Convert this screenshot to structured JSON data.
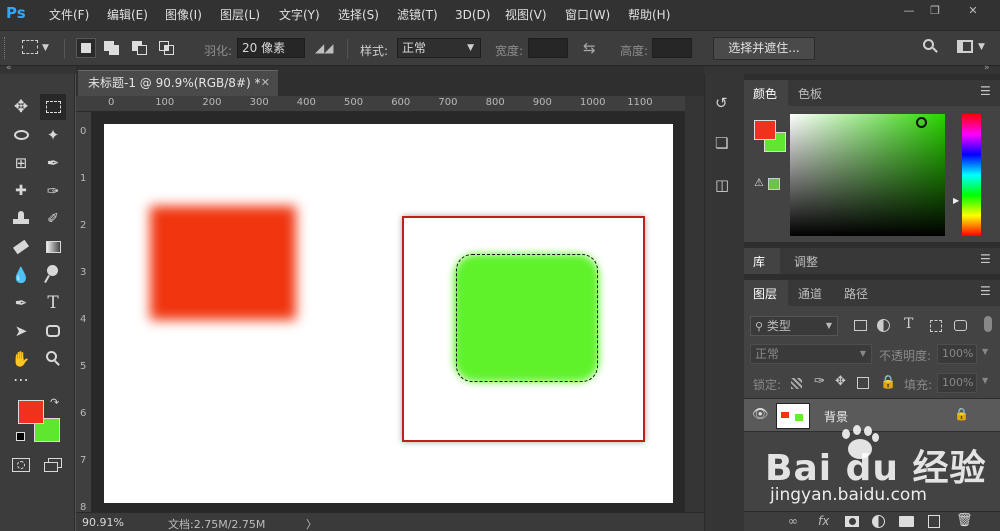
{
  "app": {
    "logo": "Ps"
  },
  "menu": [
    "文件(F)",
    "编辑(E)",
    "图像(I)",
    "图层(L)",
    "文字(Y)",
    "选择(S)",
    "滤镜(T)",
    "3D(D)",
    "视图(V)",
    "窗口(W)",
    "帮助(H)"
  ],
  "options": {
    "feather_label": "羽化:",
    "feather_value": "20 像素",
    "style_label": "样式:",
    "style_value": "正常",
    "width_label": "宽度:",
    "height_label": "高度:",
    "select_mask_button": "选择并遮住..."
  },
  "document": {
    "tab_title": "未标题-1 @ 90.9%(RGB/8#) *",
    "ruler_top": [
      "0",
      "100",
      "200",
      "300",
      "400",
      "500",
      "600",
      "700",
      "800",
      "900",
      "1000",
      "1100"
    ],
    "ruler_left": [
      "0",
      "1",
      "2",
      "3",
      "4",
      "5",
      "6",
      "7",
      "8"
    ],
    "status_zoom": "90.91%",
    "status_doc": "文档:2.75M/2.75M",
    "status_arrow": "〉"
  },
  "colors": {
    "foreground": "#f0311b",
    "background": "#5fe62e",
    "canvas_red": "#f0350f",
    "canvas_green": "#5ff22b",
    "frame_red": "#c0201c"
  },
  "color_panel": {
    "tabs": [
      "颜色",
      "色板"
    ]
  },
  "library_panel": {
    "tabs": [
      "库",
      "调整"
    ]
  },
  "layers_panel": {
    "tabs": [
      "图层",
      "通道",
      "路径"
    ],
    "filter_kind": "类型",
    "blend_mode": "正常",
    "opacity_label": "不透明度:",
    "opacity_value": "100%",
    "lock_label": "锁定:",
    "fill_label": "填充:",
    "fill_value": "100%",
    "layers": [
      {
        "name": "背景"
      }
    ],
    "footer_icons": [
      "link-icon",
      "fx-icon",
      "mask-icon",
      "adjustment-icon",
      "group-icon",
      "new-layer-icon",
      "trash-icon"
    ],
    "fx_label": "fx"
  },
  "watermark": {
    "text": "Bai du 经验",
    "url": "jingyan.baidu.com"
  }
}
